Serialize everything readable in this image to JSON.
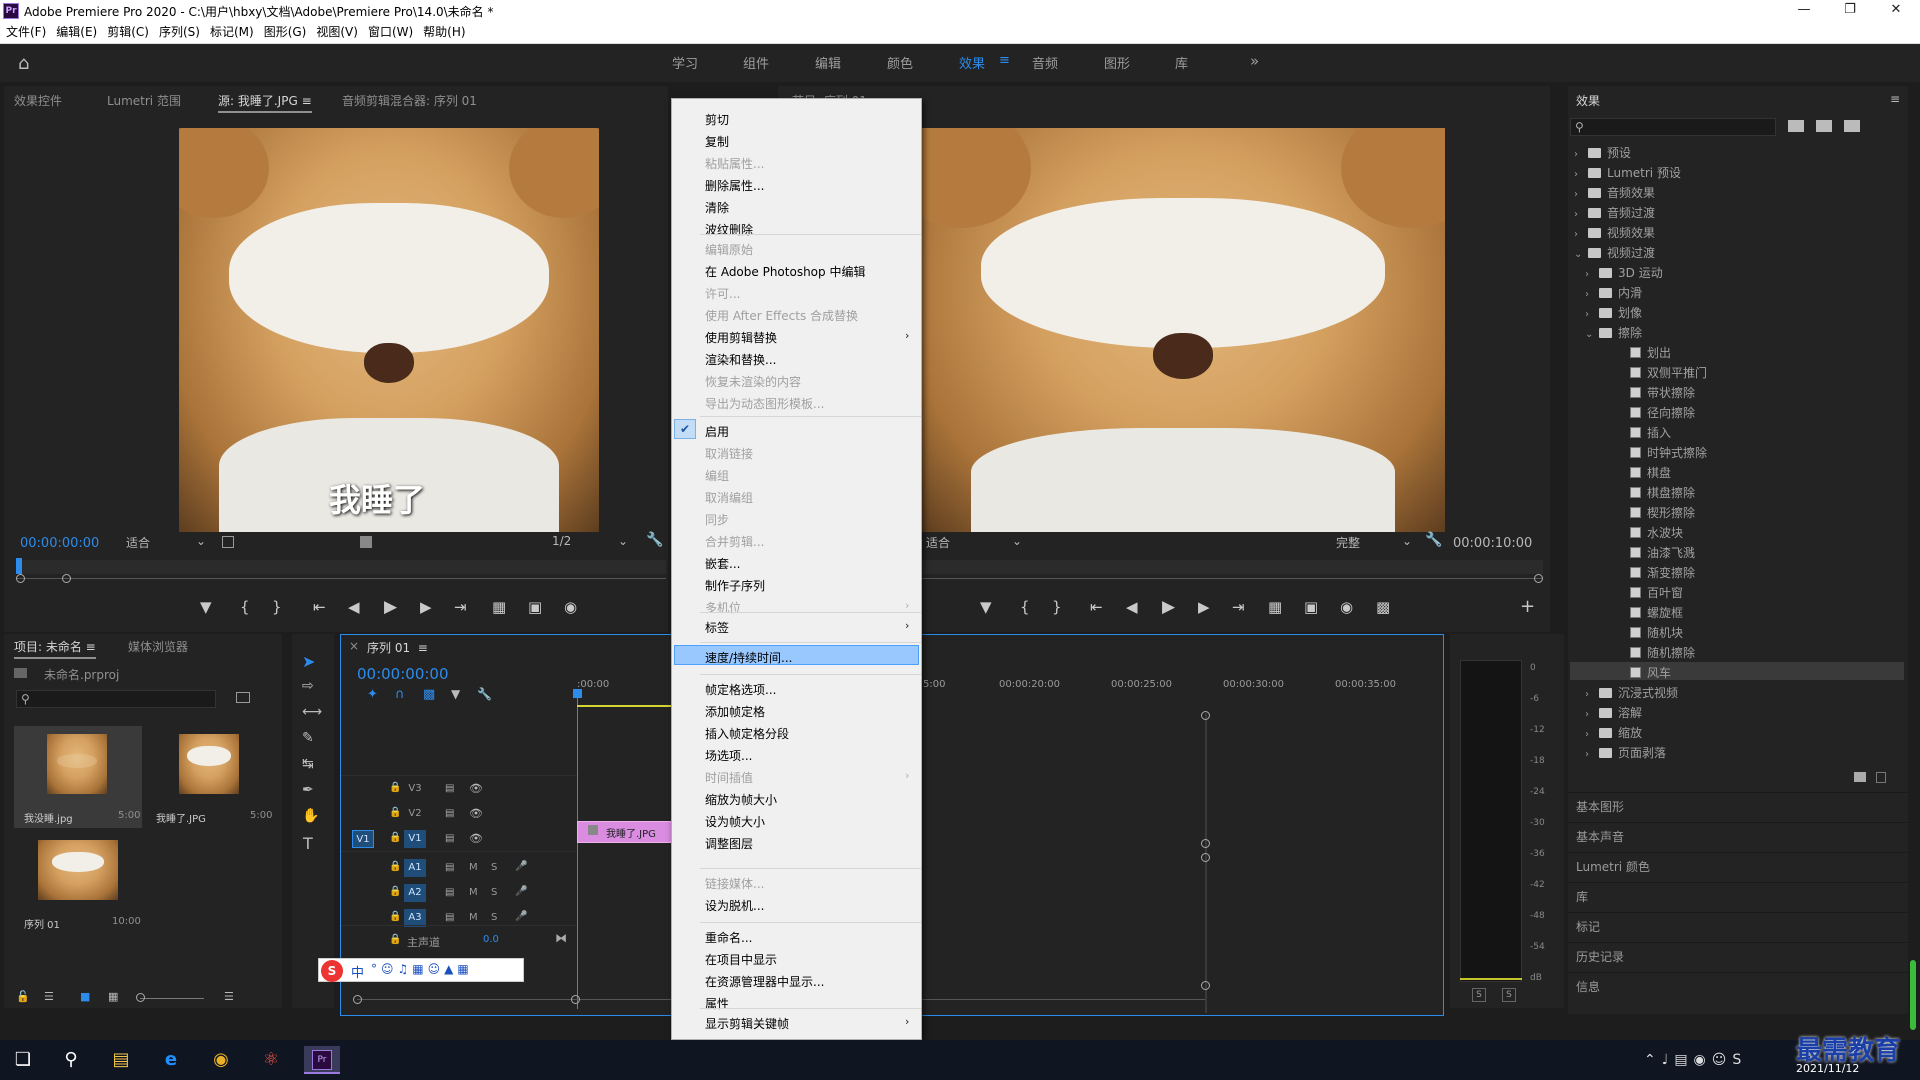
{
  "window": {
    "title": "Adobe Premiere Pro 2020 - C:\\用户\\hbxy\\文档\\Adobe\\Premiere Pro\\14.0\\未命名 *",
    "app_icon": "Pr"
  },
  "menubar": [
    "文件(F)",
    "编辑(E)",
    "剪辑(C)",
    "序列(S)",
    "标记(M)",
    "图形(G)",
    "视图(V)",
    "窗口(W)",
    "帮助(H)"
  ],
  "workspaces": {
    "items": [
      "学习",
      "组件",
      "编辑",
      "颜色",
      "效果",
      "音频",
      "图形",
      "库"
    ],
    "active": "效果",
    "more": "»"
  },
  "source_panel": {
    "tabs": [
      "效果控件",
      "Lumetri 范围",
      "源: 我睡了.JPG",
      "音频剪辑混合器: 序列 01"
    ],
    "active_tab": "源: 我睡了.JPG",
    "caption": "我睡了",
    "timecode": "00:00:00:00",
    "fit": "适合",
    "resolution": "1/2"
  },
  "program_panel": {
    "title": "节目: 序列 01",
    "fit": "适合",
    "quality": "完整",
    "timecode": "00:00:10:00"
  },
  "project_panel": {
    "tabs": [
      "项目: 未命名",
      "媒体浏览器"
    ],
    "active_tab": "项目: 未命名",
    "file": "未命名.prproj",
    "items": [
      {
        "name": "我没睡.jpg",
        "duration": "5:00"
      },
      {
        "name": "我睡了.JPG",
        "duration": "5:00"
      },
      {
        "name": "序列 01",
        "duration": "10:00"
      }
    ]
  },
  "timeline": {
    "tab": "序列 01",
    "timecode": "00:00:00:00",
    "ruler": [
      ":00:00",
      "5:00",
      "00:00:20:00",
      "00:00:25:00",
      "00:00:30:00",
      "00:00:35:00"
    ],
    "video_tracks": [
      "V3",
      "V2",
      "V1"
    ],
    "audio_tracks": [
      "A1",
      "A2",
      "A3"
    ],
    "source_patch": "V1",
    "master": "主声道",
    "master_value": "0.0",
    "clip": "我睡了.JPG",
    "m": "M",
    "s": "S"
  },
  "context_menu": {
    "g1": [
      {
        "label": "剪切",
        "enabled": true
      },
      {
        "label": "复制",
        "enabled": true
      },
      {
        "label": "粘贴属性...",
        "enabled": false
      },
      {
        "label": "删除属性...",
        "enabled": true
      },
      {
        "label": "清除",
        "enabled": true
      },
      {
        "label": "波纹删除",
        "enabled": true
      }
    ],
    "g2": [
      {
        "label": "编辑原始",
        "enabled": false
      },
      {
        "label": "在 Adobe Photoshop 中编辑",
        "enabled": true
      },
      {
        "label": "许可...",
        "enabled": false
      },
      {
        "label": "使用 After Effects 合成替换",
        "enabled": false
      },
      {
        "label": "使用剪辑替换",
        "enabled": true,
        "submenu": true
      },
      {
        "label": "渲染和替换...",
        "enabled": true
      },
      {
        "label": "恢复未渲染的内容",
        "enabled": false
      },
      {
        "label": "导出为动态图形模板...",
        "enabled": false
      }
    ],
    "g3": [
      {
        "label": "启用",
        "enabled": true,
        "checked": true
      },
      {
        "label": "取消链接",
        "enabled": false
      },
      {
        "label": "编组",
        "enabled": false
      },
      {
        "label": "取消编组",
        "enabled": false
      },
      {
        "label": "同步",
        "enabled": false
      },
      {
        "label": "合并剪辑...",
        "enabled": false
      },
      {
        "label": "嵌套...",
        "enabled": true
      },
      {
        "label": "制作子序列",
        "enabled": true
      },
      {
        "label": "多机位",
        "enabled": false,
        "submenu": true
      }
    ],
    "g4": [
      {
        "label": "标签",
        "enabled": true,
        "submenu": true
      }
    ],
    "g5": [
      {
        "label": "速度/持续时间...",
        "enabled": true,
        "highlighted": true
      }
    ],
    "g6": [
      {
        "label": "帧定格选项...",
        "enabled": true
      },
      {
        "label": "添加帧定格",
        "enabled": true
      },
      {
        "label": "插入帧定格分段",
        "enabled": true
      },
      {
        "label": "场选项...",
        "enabled": true
      },
      {
        "label": "时间插值",
        "enabled": false,
        "submenu": true
      },
      {
        "label": "缩放为帧大小",
        "enabled": true
      },
      {
        "label": "设为帧大小",
        "enabled": true
      },
      {
        "label": "调整图层",
        "enabled": true
      }
    ],
    "g7": [
      {
        "label": "链接媒体...",
        "enabled": false
      },
      {
        "label": "设为脱机...",
        "enabled": true
      }
    ],
    "g8": [
      {
        "label": "重命名...",
        "enabled": true
      },
      {
        "label": "在项目中显示",
        "enabled": true
      },
      {
        "label": "在资源管理器中显示...",
        "enabled": true
      },
      {
        "label": "属性",
        "enabled": true
      }
    ],
    "g9": [
      {
        "label": "显示剪辑关键帧",
        "enabled": true,
        "submenu": true
      }
    ]
  },
  "effects_panel": {
    "title": "效果",
    "tree": [
      {
        "label": "预设",
        "depth": 0,
        "kind": "folder",
        "open": false
      },
      {
        "label": "Lumetri 预设",
        "depth": 0,
        "kind": "folder",
        "open": false
      },
      {
        "label": "音频效果",
        "depth": 0,
        "kind": "folder",
        "open": false
      },
      {
        "label": "音频过渡",
        "depth": 0,
        "kind": "folder",
        "open": false
      },
      {
        "label": "视频效果",
        "depth": 0,
        "kind": "folder",
        "open": false
      },
      {
        "label": "视频过渡",
        "depth": 0,
        "kind": "folder",
        "open": true
      },
      {
        "label": "3D 运动",
        "depth": 1,
        "kind": "folder",
        "open": false
      },
      {
        "label": "内滑",
        "depth": 1,
        "kind": "folder",
        "open": false
      },
      {
        "label": "划像",
        "depth": 1,
        "kind": "folder",
        "open": false
      },
      {
        "label": "擦除",
        "depth": 1,
        "kind": "folder",
        "open": true
      },
      {
        "label": "划出",
        "depth": 2,
        "kind": "fx"
      },
      {
        "label": "双侧平推门",
        "depth": 2,
        "kind": "fx"
      },
      {
        "label": "带状擦除",
        "depth": 2,
        "kind": "fx"
      },
      {
        "label": "径向擦除",
        "depth": 2,
        "kind": "fx"
      },
      {
        "label": "插入",
        "depth": 2,
        "kind": "fx"
      },
      {
        "label": "时钟式擦除",
        "depth": 2,
        "kind": "fx"
      },
      {
        "label": "棋盘",
        "depth": 2,
        "kind": "fx"
      },
      {
        "label": "棋盘擦除",
        "depth": 2,
        "kind": "fx"
      },
      {
        "label": "楔形擦除",
        "depth": 2,
        "kind": "fx"
      },
      {
        "label": "水波块",
        "depth": 2,
        "kind": "fx"
      },
      {
        "label": "油漆飞溅",
        "depth": 2,
        "kind": "fx"
      },
      {
        "label": "渐变擦除",
        "depth": 2,
        "kind": "fx"
      },
      {
        "label": "百叶窗",
        "depth": 2,
        "kind": "fx"
      },
      {
        "label": "螺旋框",
        "depth": 2,
        "kind": "fx"
      },
      {
        "label": "随机块",
        "depth": 2,
        "kind": "fx"
      },
      {
        "label": "随机擦除",
        "depth": 2,
        "kind": "fx"
      },
      {
        "label": "风车",
        "depth": 2,
        "kind": "fx",
        "selected": true
      },
      {
        "label": "沉浸式视频",
        "depth": 1,
        "kind": "folder",
        "open": false
      },
      {
        "label": "溶解",
        "depth": 1,
        "kind": "folder",
        "open": false
      },
      {
        "label": "缩放",
        "depth": 1,
        "kind": "folder",
        "open": false
      },
      {
        "label": "页面剥落",
        "depth": 1,
        "kind": "folder",
        "open": false
      }
    ],
    "sections": [
      "基本图形",
      "基本声音",
      "Lumetri 颜色",
      "库",
      "标记",
      "历史记录",
      "信息"
    ]
  },
  "audio_meter": {
    "scale": [
      "0",
      "-6",
      "-12",
      "-18",
      "-24",
      "-30",
      "-36",
      "-42",
      "-48",
      "-54",
      "dB"
    ],
    "solo": [
      "S",
      "S"
    ]
  },
  "ime_toolbar": {
    "label": "中"
  },
  "taskbar": {
    "date": "2021/11/12",
    "watermark": "最需教育"
  }
}
